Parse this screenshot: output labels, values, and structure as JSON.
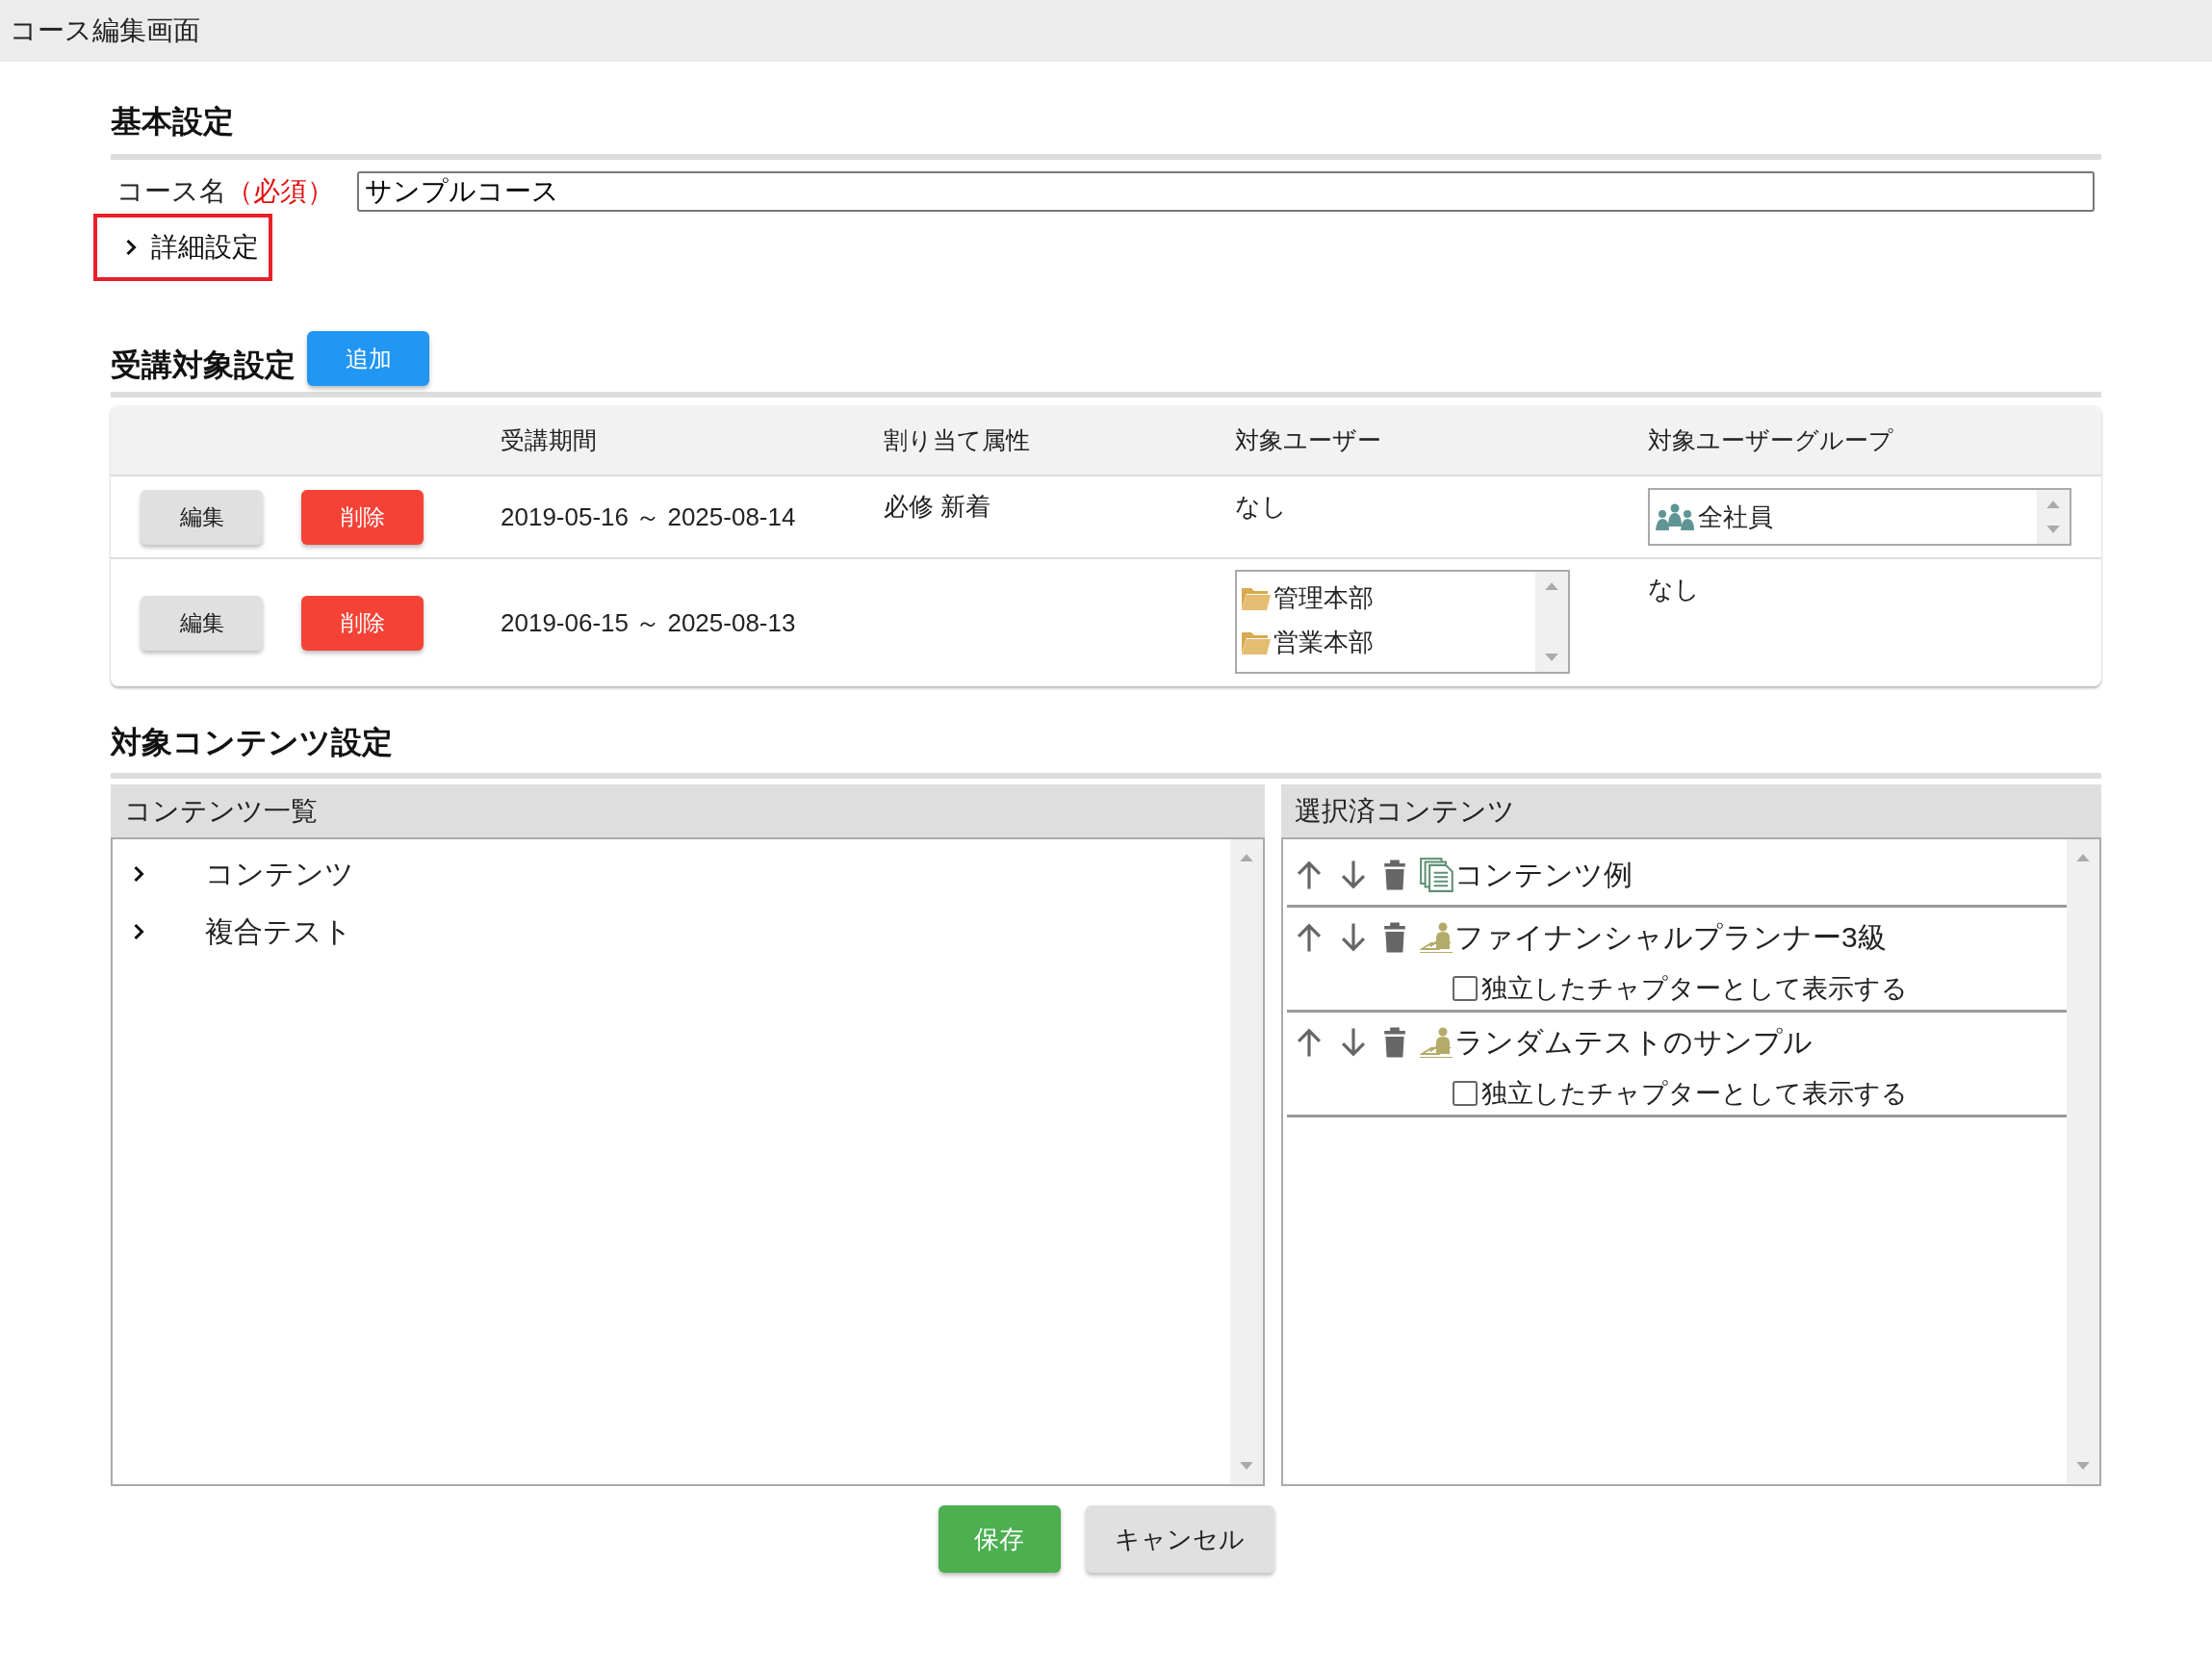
{
  "window": {
    "title": "コース編集画面"
  },
  "basic": {
    "heading": "基本設定",
    "course_name": {
      "label": "コース名",
      "required": "（必須）",
      "value": "サンプルコース"
    },
    "details": {
      "label": "詳細設定",
      "expanded": false,
      "highlighted": true
    }
  },
  "targets": {
    "heading": "受講対象設定",
    "add_button": "追加",
    "columns": [
      "受講期間",
      "割り当て属性",
      "対象ユーザー",
      "対象ユーザーグループ"
    ],
    "rows": [
      {
        "edit": "編集",
        "delete": "削除",
        "period": "2019-05-16 ～ 2025-08-14",
        "attributes": "必修 新着",
        "users": {
          "kind": "text",
          "text": "なし"
        },
        "groups": {
          "kind": "list",
          "items": [
            {
              "kind": "group",
              "label": "全社員"
            }
          ]
        }
      },
      {
        "edit": "編集",
        "delete": "削除",
        "period": "2019-06-15 ～ 2025-08-13",
        "users": {
          "kind": "list",
          "items": [
            {
              "kind": "folder",
              "label": "管理本部"
            },
            {
              "kind": "folder",
              "label": "営業本部"
            }
          ]
        },
        "groups": {
          "kind": "text",
          "text": "なし"
        }
      }
    ]
  },
  "contents": {
    "heading": "対象コンテンツ設定",
    "available": {
      "title": "コンテンツ一覧",
      "items": [
        {
          "label": "コンテンツ",
          "expanded": false
        },
        {
          "label": "複合テスト",
          "expanded": false
        }
      ]
    },
    "selected": {
      "title": "選択済コンテンツ",
      "items": [
        {
          "kind": "document",
          "label": "コンテンツ例"
        },
        {
          "kind": "test",
          "label": "ファイナンシャルプランナー3級",
          "option": {
            "label": "独立したチャプターとして表示する",
            "checked": false
          }
        },
        {
          "kind": "test",
          "label": "ランダムテストのサンプル",
          "option": {
            "label": "独立したチャプターとして表示する",
            "checked": false
          }
        }
      ]
    }
  },
  "actions": {
    "save": "保存",
    "cancel": "キャンセル"
  }
}
